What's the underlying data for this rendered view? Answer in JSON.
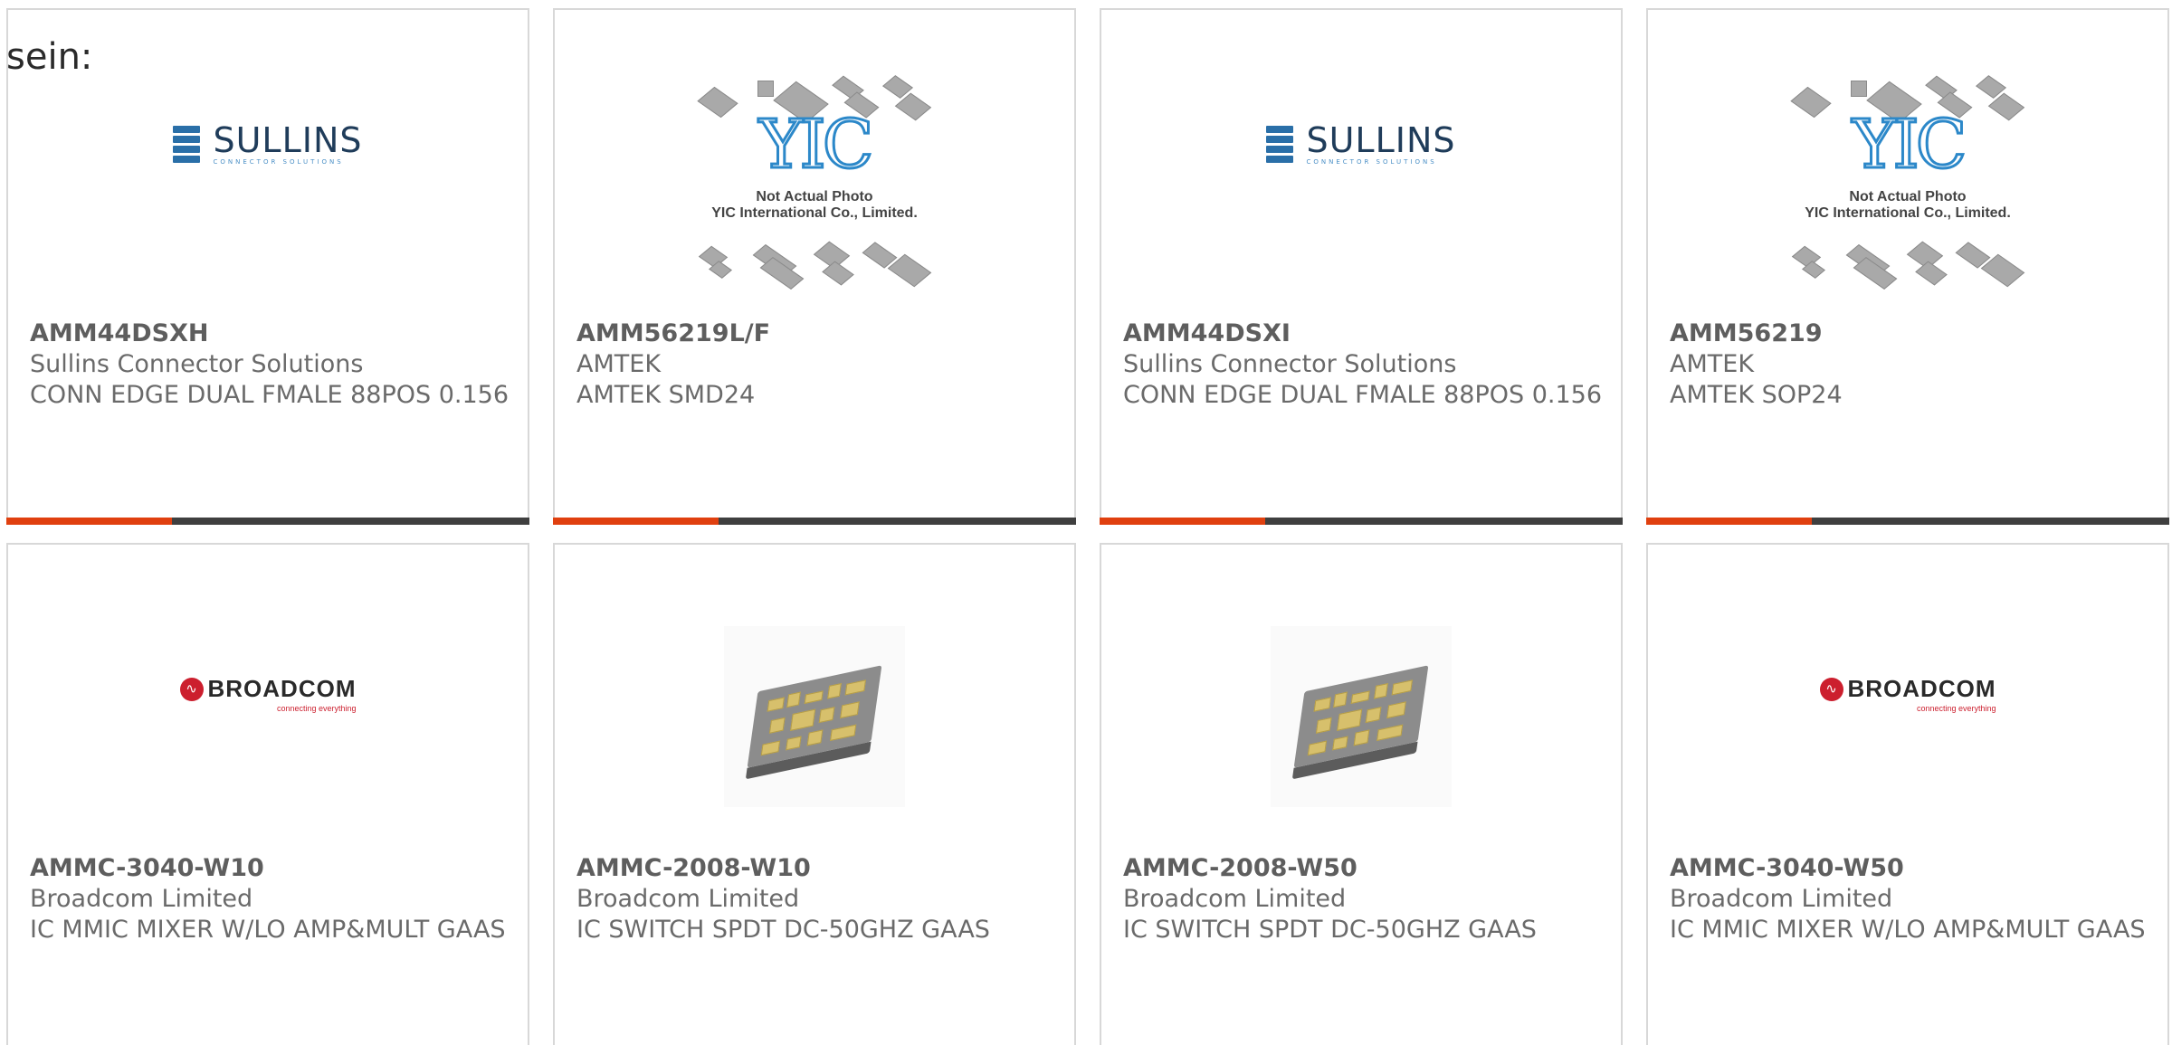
{
  "page": {
    "text_fragment": "sein:",
    "accent_color": "#e0400f",
    "bar_color": "#3f3f3f"
  },
  "logos": {
    "sullins": {
      "word": "SULLINS",
      "sub": "CONNECTOR SOLUTIONS"
    },
    "yic": {
      "mark": "YIC",
      "line1": "Not Actual Photo",
      "line2": "YIC International Co., Limited."
    },
    "broadcom": {
      "word": "BROADCOM",
      "tagline": "connecting everything"
    }
  },
  "products": [
    {
      "part": "AMM44DSXH",
      "manufacturer": "Sullins Connector Solutions",
      "description": "CONN EDGE DUAL FMALE 88POS 0.156",
      "image": "sullins-logo"
    },
    {
      "part": "AMM56219L/F",
      "manufacturer": "AMTEK",
      "description": "AMTEK SMD24",
      "image": "yic-placeholder"
    },
    {
      "part": "AMM44DSXI",
      "manufacturer": "Sullins Connector Solutions",
      "description": "CONN EDGE DUAL FMALE 88POS 0.156",
      "image": "sullins-logo"
    },
    {
      "part": "AMM56219",
      "manufacturer": "AMTEK",
      "description": "AMTEK SOP24",
      "image": "yic-placeholder"
    },
    {
      "part": "AMMC-3040-W10",
      "manufacturer": "Broadcom Limited",
      "description": "IC MMIC MIXER W/LO AMP&MULT GAAS",
      "image": "broadcom-logo"
    },
    {
      "part": "AMMC-2008-W10",
      "manufacturer": "Broadcom Limited",
      "description": "IC SWITCH SPDT DC-50GHZ GAAS",
      "image": "mmic-package"
    },
    {
      "part": "AMMC-2008-W50",
      "manufacturer": "Broadcom Limited",
      "description": "IC SWITCH SPDT DC-50GHZ GAAS",
      "image": "mmic-package"
    },
    {
      "part": "AMMC-3040-W50",
      "manufacturer": "Broadcom Limited",
      "description": "IC MMIC MIXER W/LO AMP&MULT GAAS",
      "image": "broadcom-logo"
    }
  ]
}
